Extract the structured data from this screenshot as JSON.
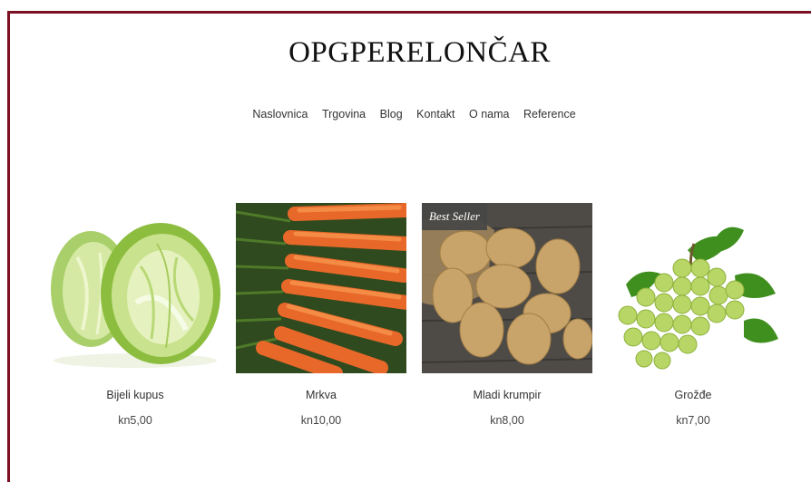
{
  "header": {
    "site_title": "OPGPERELONČAR"
  },
  "nav": {
    "items": [
      {
        "label": "Naslovnica"
      },
      {
        "label": "Trgovina"
      },
      {
        "label": "Blog"
      },
      {
        "label": "Kontakt"
      },
      {
        "label": "O nama"
      },
      {
        "label": "Reference"
      }
    ]
  },
  "products": [
    {
      "name": "Bijeli kupus",
      "price": "kn5,00",
      "image": "cabbage-image"
    },
    {
      "name": "Mrkva",
      "price": "kn10,00",
      "image": "carrots-image"
    },
    {
      "name": "Mladi krumpir",
      "price": "kn8,00",
      "image": "potatoes-image",
      "badge": "Best Seller"
    },
    {
      "name": "Grožđe",
      "price": "kn7,00",
      "image": "grapes-image"
    }
  ],
  "colors": {
    "frame_border": "#7b1022",
    "badge_bg": "#464646"
  }
}
